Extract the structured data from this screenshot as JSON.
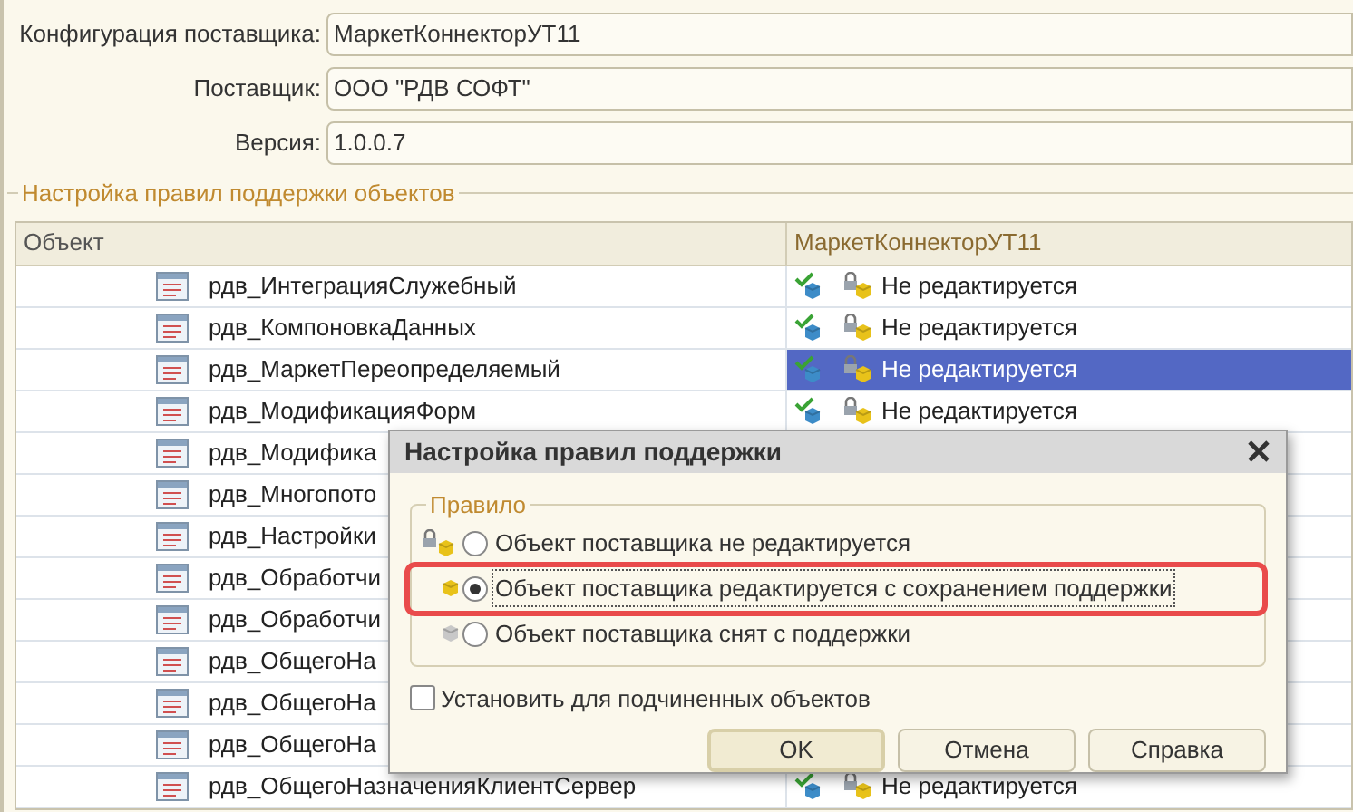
{
  "form_fields": [
    {
      "label": "Конфигурация поставщика:",
      "value": "МаркетКоннекторУТ11"
    },
    {
      "label": "Поставщик:",
      "value": "ООО \"РДВ СОФТ\""
    },
    {
      "label": "Версия:",
      "value": "1.0.0.7"
    }
  ],
  "group_title": "Настройка правил поддержки объектов",
  "table": {
    "columns": [
      "Объект",
      "МаркетКоннекторУТ11"
    ],
    "rows": [
      {
        "name": "рдв_ИнтеграцияСлужебный",
        "status": "Не редактируется",
        "selected": false
      },
      {
        "name": "рдв_КомпоновкаДанных",
        "status": "Не редактируется",
        "selected": false
      },
      {
        "name": "рдв_МаркетПереопределяемый",
        "status": "Не редактируется",
        "selected": true
      },
      {
        "name": "рдв_МодификацияФорм",
        "status": "Не редактируется",
        "selected": false
      },
      {
        "name": "рдв_Модифика",
        "selected": false
      },
      {
        "name": "рдв_Многопото",
        "selected": false
      },
      {
        "name": "рдв_Настройки",
        "selected": false
      },
      {
        "name": "рдв_Обработчи",
        "selected": false
      },
      {
        "name": "рдв_Обработчи",
        "selected": false
      },
      {
        "name": "рдв_ОбщегоНа",
        "selected": false
      },
      {
        "name": "рдв_ОбщегоНа",
        "selected": false
      },
      {
        "name": "рдв_ОбщегоНа",
        "selected": false
      },
      {
        "name": "рдв_ОбщегоНазначенияКлиентСервер",
        "status": "Не редактируется",
        "selected": false
      }
    ]
  },
  "dialog": {
    "title": "Настройка правил поддержки",
    "group_title": "Правило",
    "options": [
      {
        "kind": "locked",
        "label": "Объект поставщика не редактируется",
        "selected": false,
        "highlighted": false
      },
      {
        "kind": "editable",
        "label": "Объект поставщика редактируется с сохранением поддержки",
        "selected": true,
        "highlighted": true
      },
      {
        "kind": "removed",
        "label": "Объект поставщика снят с поддержки",
        "selected": false,
        "highlighted": false
      }
    ],
    "checkbox": {
      "label": "Установить для подчиненных объектов",
      "checked": false
    },
    "buttons": [
      {
        "label": "OK",
        "default": true
      },
      {
        "label": "Отмена",
        "default": false
      },
      {
        "label": "Справка",
        "default": false
      }
    ]
  }
}
